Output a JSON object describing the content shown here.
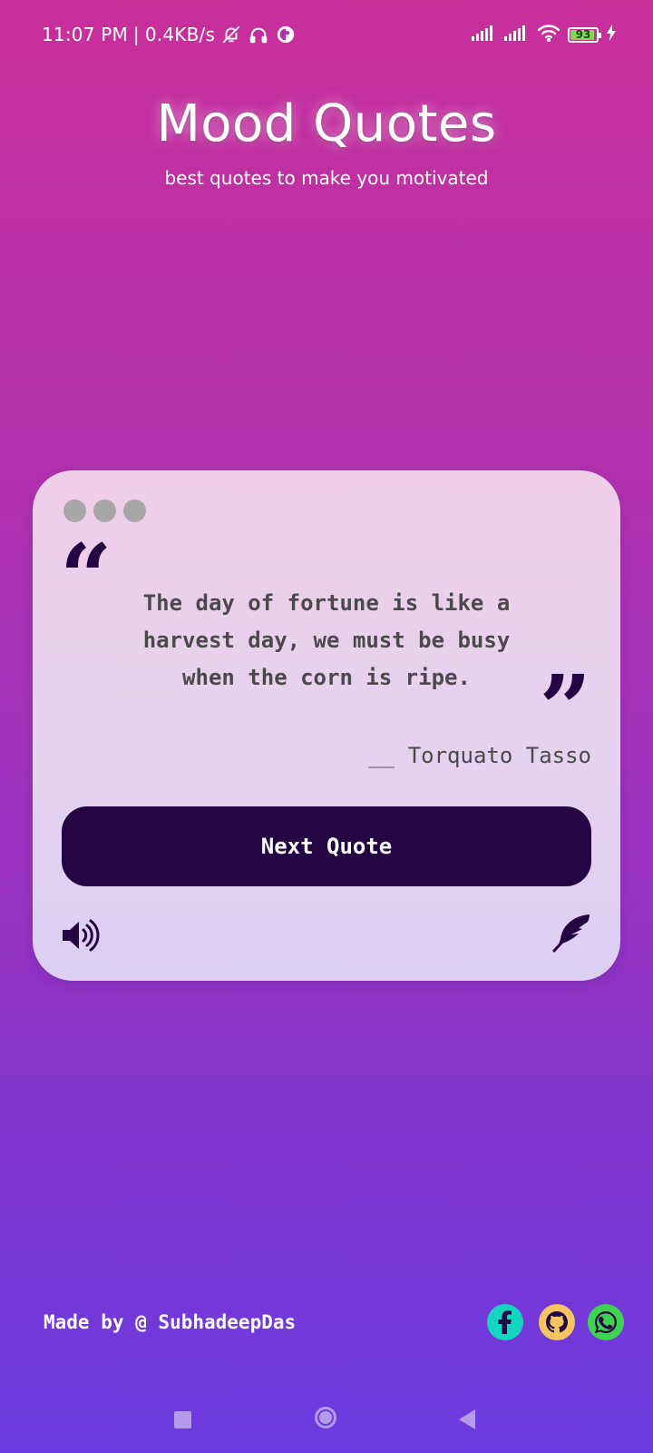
{
  "status_bar": {
    "time": "11:07 PM",
    "separator": "|",
    "net_speed": "0.4KB/s",
    "battery": "93",
    "icons": [
      "bell-off-icon",
      "headphones-icon",
      "vpn-icon",
      "signal-icon",
      "signal-icon",
      "wifi-icon",
      "battery-icon",
      "charging-icon"
    ]
  },
  "header": {
    "title": "Mood Quotes",
    "subtitle": "best quotes to make you motivated"
  },
  "card": {
    "window_dots": 3,
    "quote_open_glyph": "“",
    "quote_close_glyph": "”",
    "quote_text": "The day of fortune is like a harvest day, we must be busy when the corn is ripe.",
    "author": "__ Torquato Tasso",
    "next_button_label": "Next Quote",
    "icons": [
      "speaker-icon",
      "feather-icon"
    ]
  },
  "footer": {
    "credit": "Made by @ SubhadeepDas",
    "social_icons": [
      "facebook-icon",
      "github-icon",
      "whatsapp-icon"
    ]
  },
  "colors": {
    "gradient_top": "#c82f9b",
    "gradient_bottom": "#6a3ae0",
    "card_bg": "#e6d2ef",
    "button_bg": "#250444",
    "quote_text": "#4a4a4a",
    "dot": "#a7a7a7",
    "facebook": "#14d6c0",
    "github": "#f4c560",
    "whatsapp": "#3ed34f",
    "nav": "#b49ae9"
  }
}
